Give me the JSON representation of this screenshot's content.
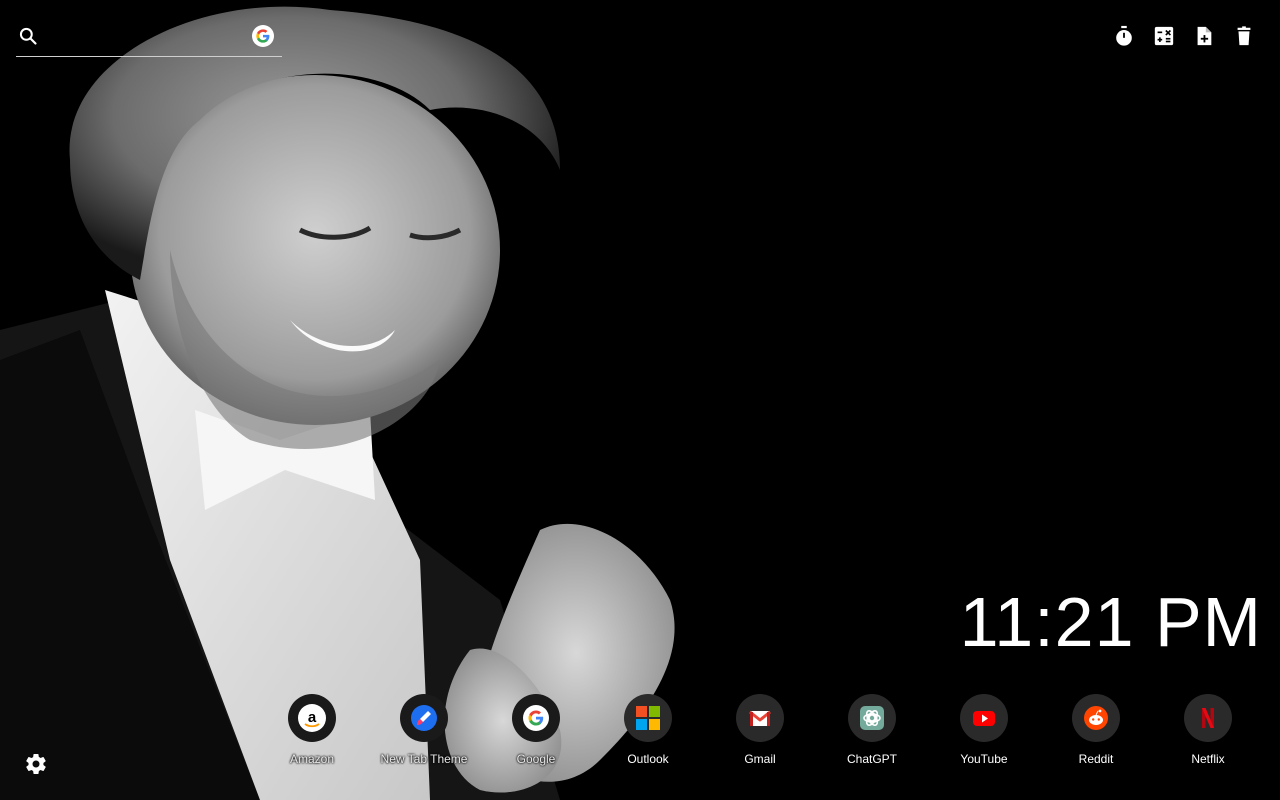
{
  "search": {
    "placeholder": "",
    "value": "",
    "engine_icon": "google-icon"
  },
  "toolbar": {
    "items": [
      {
        "icon": "stopwatch-icon"
      },
      {
        "icon": "calculator-icon"
      },
      {
        "icon": "note-add-icon"
      },
      {
        "icon": "trash-icon"
      }
    ]
  },
  "clock": {
    "time": "11:21 PM"
  },
  "shortcuts": [
    {
      "label": "Amazon",
      "icon": "amazon-icon"
    },
    {
      "label": "New Tab Theme",
      "icon": "brush-icon"
    },
    {
      "label": "Google",
      "icon": "google-icon"
    },
    {
      "label": "Outlook",
      "icon": "microsoft-icon"
    },
    {
      "label": "Gmail",
      "icon": "gmail-icon"
    },
    {
      "label": "ChatGPT",
      "icon": "chatgpt-icon"
    },
    {
      "label": "YouTube",
      "icon": "youtube-icon"
    },
    {
      "label": "Reddit",
      "icon": "reddit-icon"
    },
    {
      "label": "Netflix",
      "icon": "netflix-icon"
    }
  ],
  "settings": {
    "icon": "gear-icon"
  },
  "colors": {
    "background": "#000000",
    "text": "#ffffff",
    "shortcut_circle": "#2a2a2a"
  }
}
